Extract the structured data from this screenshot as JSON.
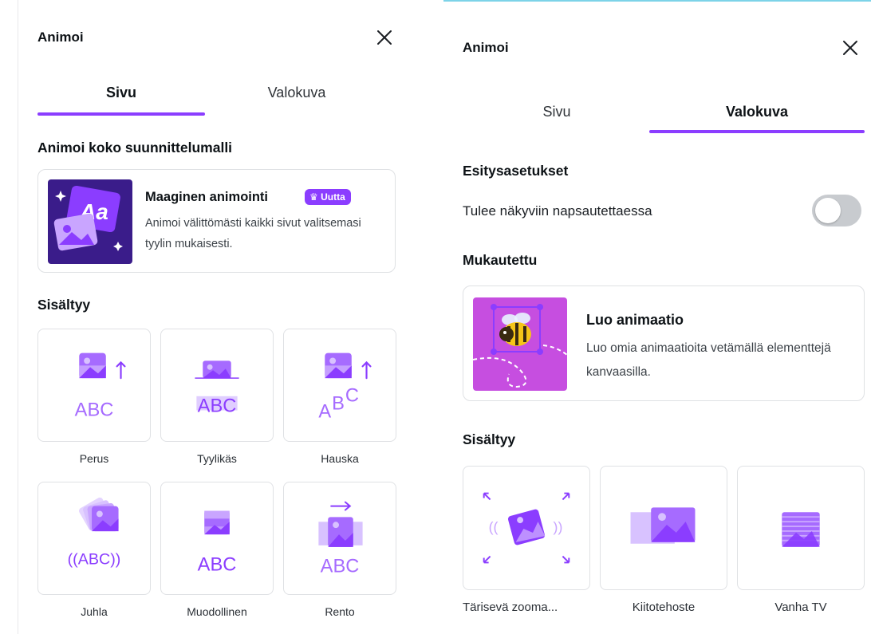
{
  "left_panel": {
    "title": "Animoi",
    "tabs": [
      {
        "label": "Sivu",
        "active": true
      },
      {
        "label": "Valokuva",
        "active": false
      }
    ],
    "section_whole": "Animoi koko suunnittelumalli",
    "magic": {
      "title": "Maaginen animointi",
      "badge": "Uutta",
      "description": "Animoi välittömästi kaikki sivut valitsemasi tyylin mukaisesti.",
      "thumb_text": "Aa"
    },
    "section_included": "Sisältyy",
    "tiles": [
      {
        "label": "Perus",
        "icon": "perus-animation-icon",
        "glyph": "ABC"
      },
      {
        "label": "Tyylikäs",
        "icon": "tyylikas-animation-icon",
        "glyph": "ABC"
      },
      {
        "label": "Hauska",
        "icon": "hauska-animation-icon",
        "glyph": "ABC"
      },
      {
        "label": "Juhla",
        "icon": "juhla-animation-icon",
        "glyph": "((ABC))"
      },
      {
        "label": "Muodollinen",
        "icon": "muodollinen-animation-icon",
        "glyph": "ABC"
      },
      {
        "label": "Rento",
        "icon": "rento-animation-icon",
        "glyph": "ABC"
      }
    ]
  },
  "right_panel": {
    "title": "Animoi",
    "tabs": [
      {
        "label": "Sivu",
        "active": false
      },
      {
        "label": "Valokuva",
        "active": true
      }
    ],
    "section_settings": "Esitysasetukset",
    "toggle_label": "Tulee näkyviin napsautettaessa",
    "toggle_on": false,
    "section_custom": "Mukautettu",
    "create": {
      "title": "Luo animaatio",
      "description": "Luo omia animaatioita vetämällä elementtejä kanvaasilla."
    },
    "section_included": "Sisältyy",
    "tiles": [
      {
        "label": "Tärisevä zooma...",
        "icon": "tariseva-zoom-icon"
      },
      {
        "label": "Kiitotehoste",
        "icon": "kiitotehoste-icon"
      },
      {
        "label": "Vanha TV",
        "icon": "vanha-tv-icon"
      }
    ]
  },
  "colors": {
    "accent": "#8b3dff",
    "accent_light": "#c9a5ff",
    "accent_mid": "#a66bff",
    "toggle_off": "#c8cbcf",
    "card_border": "#dfe1e4"
  }
}
